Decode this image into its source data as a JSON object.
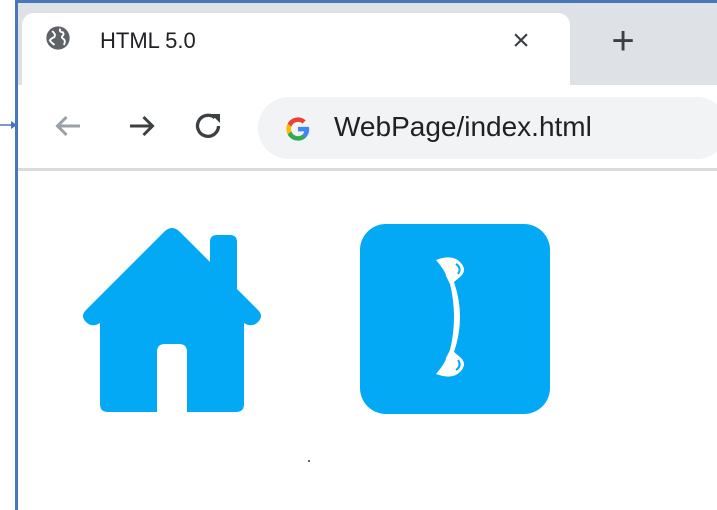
{
  "browser": {
    "tab": {
      "title": "HTML 5.0",
      "icon": "globe-icon",
      "close_label": "×"
    },
    "new_tab_label": "+",
    "nav": {
      "back_icon": "arrow-left-icon",
      "forward_icon": "arrow-right-icon",
      "reload_icon": "reload-icon"
    },
    "address": {
      "icon": "google-icon",
      "url": "WebPage/index.html"
    }
  },
  "page": {
    "icons": [
      {
        "name": "home-icon",
        "color": "#03a9f4"
      },
      {
        "name": "phone-icon",
        "color": "#03a9f4"
      }
    ]
  },
  "colors": {
    "accent": "#03a9f4",
    "tabstrip": "#dee1e6",
    "border": "#4a77b8"
  }
}
